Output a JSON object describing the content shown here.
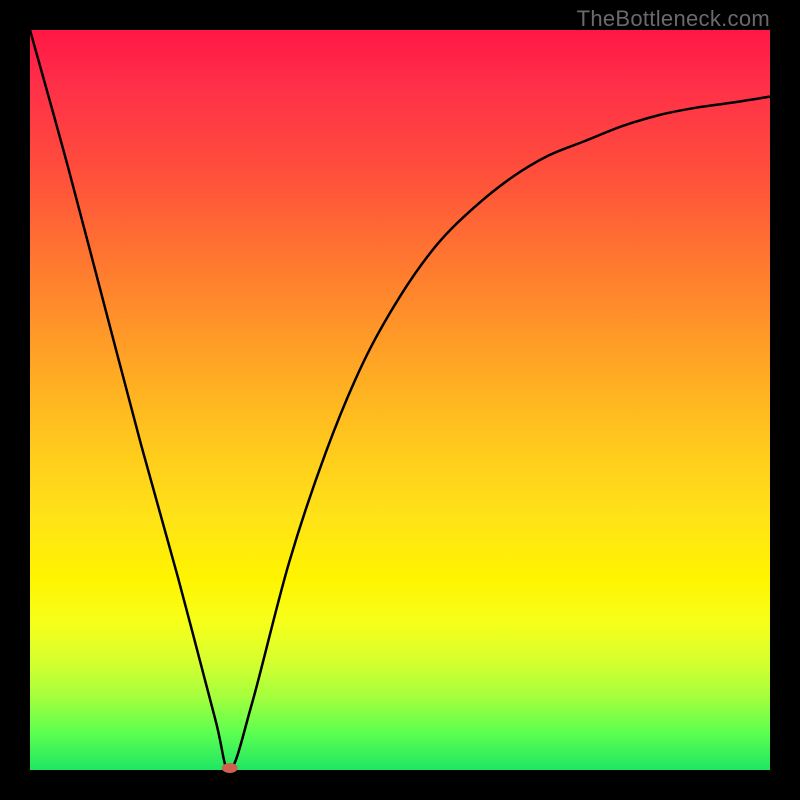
{
  "attribution": "TheBottleneck.com",
  "chart_data": {
    "type": "line",
    "title": "",
    "xlabel": "",
    "ylabel": "",
    "xlim": [
      0,
      100
    ],
    "ylim": [
      0,
      100
    ],
    "series": [
      {
        "name": "bottleneck-curve",
        "x": [
          0,
          5,
          10,
          15,
          20,
          25,
          27,
          30,
          35,
          40,
          45,
          50,
          55,
          60,
          65,
          70,
          75,
          80,
          85,
          90,
          95,
          100
        ],
        "values": [
          100,
          82,
          63,
          44,
          26,
          7,
          0,
          9,
          28,
          43,
          55,
          64,
          71,
          76,
          80,
          83,
          85,
          87,
          88.5,
          89.5,
          90.2,
          91
        ]
      }
    ],
    "marker": {
      "x": 27,
      "y": 0
    },
    "gradient_meaning": "top=red=high bottleneck, bottom=green=low bottleneck"
  }
}
